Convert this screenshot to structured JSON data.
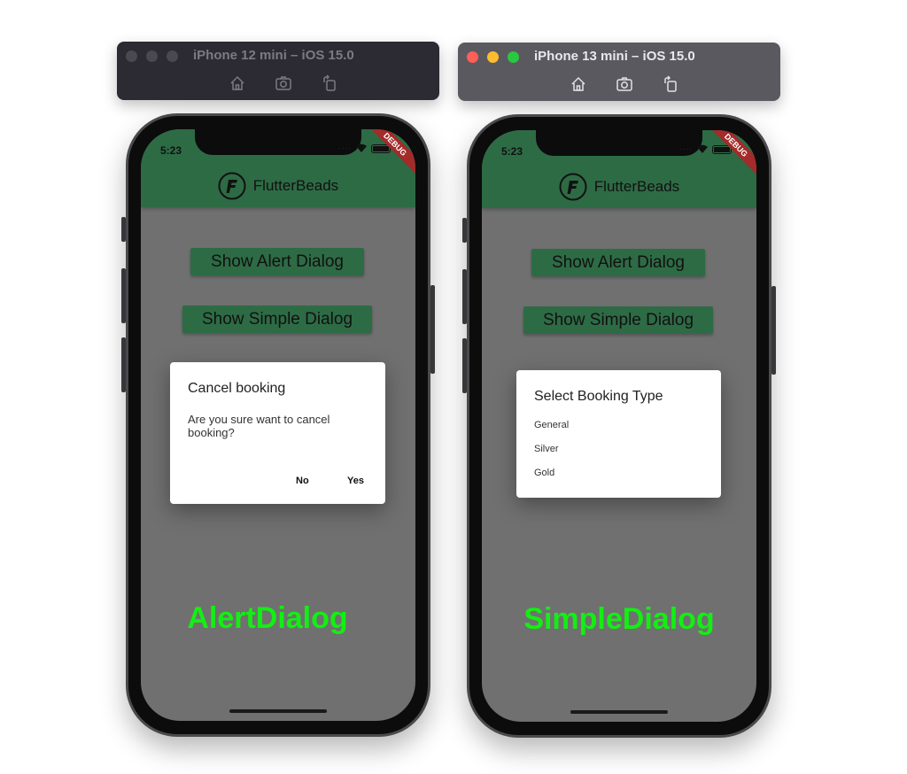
{
  "windows": [
    {
      "title": "iPhone 12 mini – iOS 15.0",
      "state": "inactive",
      "tools": [
        "home-icon",
        "screenshot-icon",
        "rotate-icon"
      ]
    },
    {
      "title": "iPhone 13 mini – iOS 15.0",
      "state": "active",
      "tools": [
        "home-icon",
        "screenshot-icon",
        "rotate-icon"
      ]
    }
  ],
  "phones": [
    {
      "status_time": "5:23",
      "debug_banner": "DEBUG",
      "app_title": "FlutterBeads",
      "buttons": [
        "Show Alert Dialog",
        "Show Simple Dialog"
      ],
      "dialog": {
        "type": "alert",
        "title": "Cancel booking",
        "content": "Are you sure want to cancel booking?",
        "actions": [
          "No",
          "Yes"
        ]
      },
      "caption": "AlertDialog"
    },
    {
      "status_time": "5:23",
      "debug_banner": "DEBUG",
      "app_title": "FlutterBeads",
      "buttons": [
        "Show Alert Dialog",
        "Show Simple Dialog"
      ],
      "dialog": {
        "type": "simple",
        "title": "Select Booking Type",
        "options": [
          "General",
          "Silver",
          "Gold"
        ]
      },
      "caption": "SimpleDialog"
    }
  ],
  "colors": {
    "appbar": "#2d6b45",
    "scrim": "#707070",
    "caption": "#13ef13",
    "debug_banner": "#a52a2a"
  }
}
